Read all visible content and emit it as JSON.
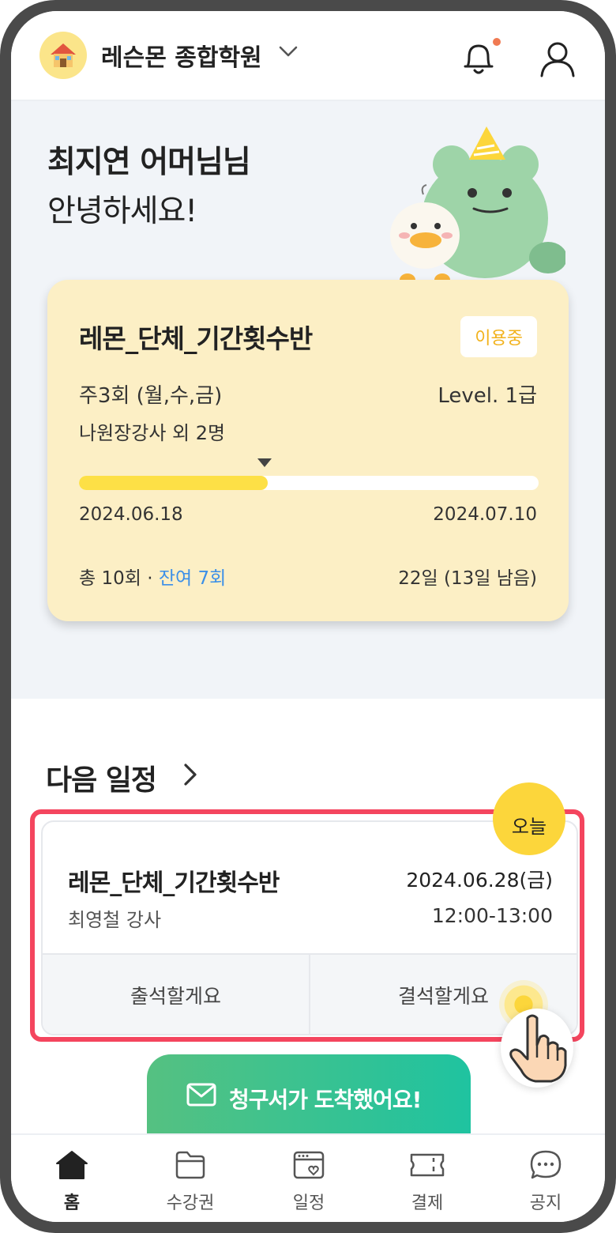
{
  "header": {
    "academy_name": "레슨몬 종합학원",
    "academy_icon": "house-emoji-icon",
    "notification_dot_color": "#f07a52"
  },
  "hero": {
    "greeting_line1": "최지연 어머님님",
    "greeting_line2": "안녕하세요!"
  },
  "pass_card": {
    "title": "레몬_단체_기간횟수반",
    "status": "이용중",
    "schedule": "주3회 (월,수,금)",
    "level": "Level. 1급",
    "teachers": "나원장강사 외 2명",
    "progress_fraction": 0.41,
    "start_date": "2024.06.18",
    "end_date": "2024.07.10",
    "total_prefix": "총 10회 · ",
    "remaining": "잔여 7회",
    "days": "22일 (13일 남음)",
    "background_color": "#fcefc5",
    "progress_color": "#fde046"
  },
  "next_schedule": {
    "section_title": "다음 일정",
    "today_badge": "오늘",
    "class_title": "레몬_단체_기간횟수반",
    "date": "2024.06.28(금)",
    "teacher": "최영철 강사",
    "time": "12:00-13:00",
    "attend_label": "출석할게요",
    "absent_label": "결석할게요",
    "highlight_color": "#f4455e"
  },
  "invoice_banner": {
    "label": "청구서가 도착했어요!"
  },
  "bottom_nav": {
    "items": [
      {
        "label": "홈",
        "icon": "home-icon",
        "active": true
      },
      {
        "label": "수강권",
        "icon": "folder-icon",
        "active": false
      },
      {
        "label": "일정",
        "icon": "calendar-icon",
        "active": false
      },
      {
        "label": "결제",
        "icon": "ticket-icon",
        "active": false
      },
      {
        "label": "공지",
        "icon": "chat-icon",
        "active": false
      }
    ]
  }
}
